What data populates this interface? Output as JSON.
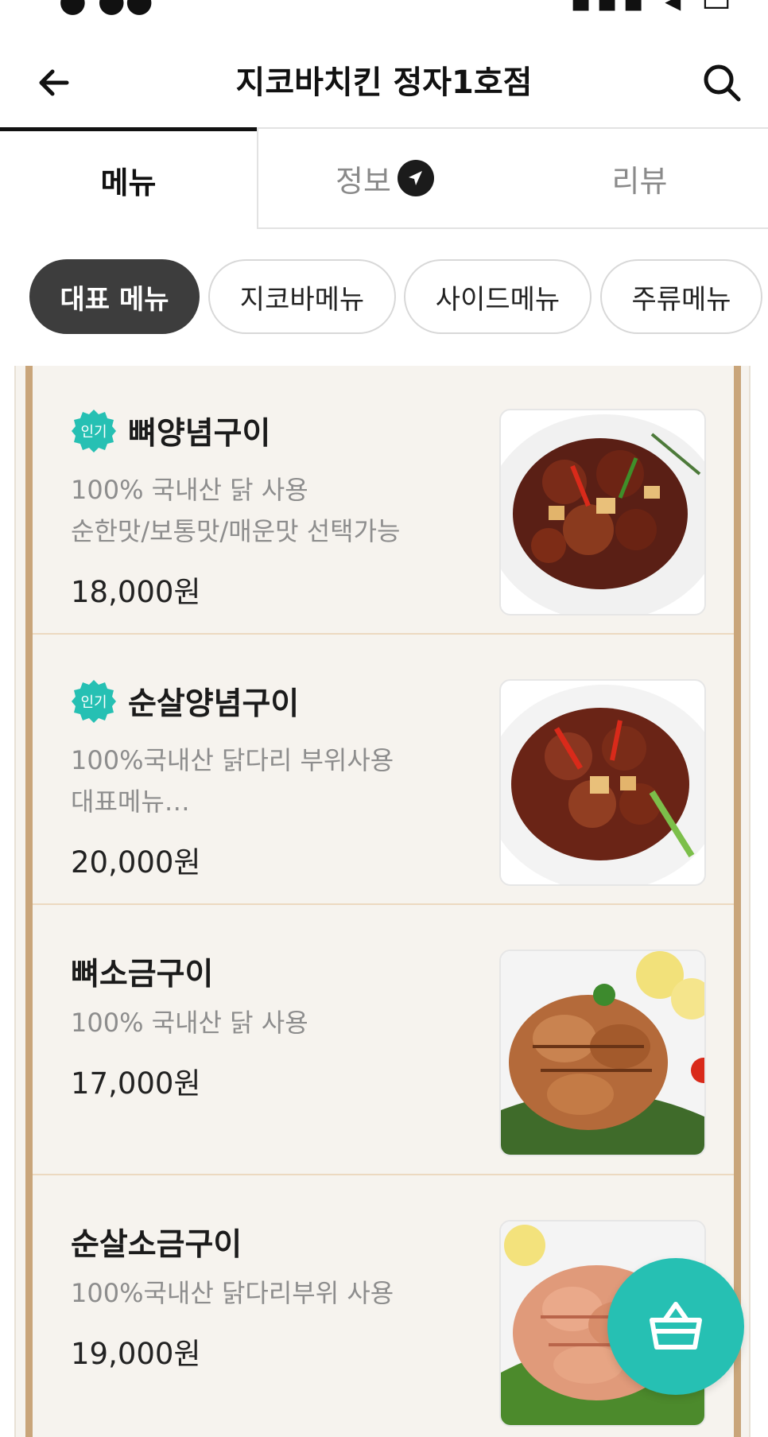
{
  "header": {
    "title": "지코바치킨 정자1호점"
  },
  "tabs": [
    {
      "label": "메뉴"
    },
    {
      "label": "정보"
    },
    {
      "label": "리뷰"
    }
  ],
  "categories": [
    {
      "label": "대표 메뉴"
    },
    {
      "label": "지코바메뉴"
    },
    {
      "label": "사이드메뉴"
    },
    {
      "label": "주류메뉴"
    }
  ],
  "items": [
    {
      "badge": "인기",
      "name": "뼈양념구이",
      "desc1": "100% 국내산 닭 사용",
      "desc2": "순한맛/보통맛/매운맛 선택가능",
      "price": "18,000원"
    },
    {
      "badge": "인기",
      "name": "순살양념구이",
      "desc1": "100%국내산 닭다리 부위사용",
      "desc2": "대표메뉴…",
      "price": "20,000원"
    },
    {
      "name": "뼈소금구이",
      "desc1": "100% 국내산 닭 사용",
      "price": "17,000원"
    },
    {
      "name": "순살소금구이",
      "desc1": "100%국내산 닭다리부위 사용",
      "price": "19,000원"
    }
  ],
  "colors": {
    "accent": "#26c0b3",
    "chip_active": "#3d3d3d",
    "board_border": "#c9a57a"
  },
  "icons": {
    "back": "arrow-left-icon",
    "search": "search-icon",
    "info_badge": "send-icon",
    "cart": "basket-icon"
  }
}
